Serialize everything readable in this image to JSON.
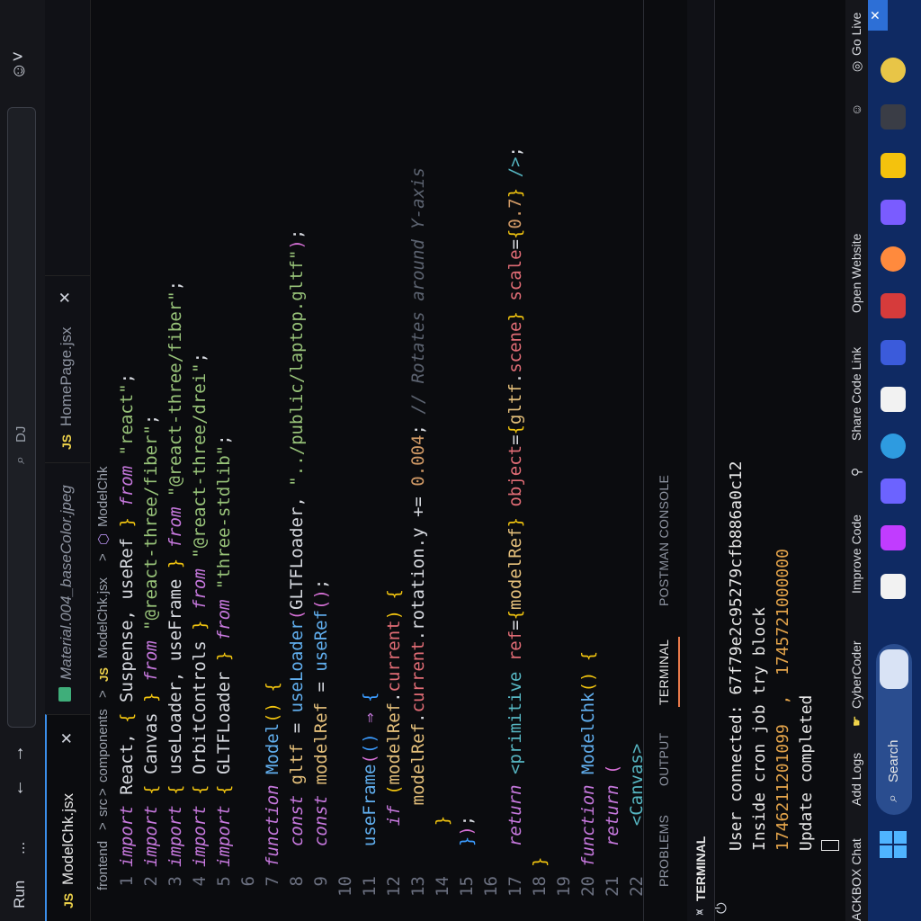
{
  "titlebar": {
    "run": "Run",
    "more": "...",
    "back": "←",
    "forward": "→",
    "search_text": "DJ"
  },
  "tabs": [
    {
      "label": "ModelChk.jsx",
      "badge": "JS",
      "close": "✕"
    },
    {
      "label": "Material.004_baseColor.jpeg"
    },
    {
      "label": "HomePage.jsx",
      "badge": "JS",
      "close": "✕"
    }
  ],
  "breadcrumb": [
    "frontend",
    ">",
    "src",
    ">",
    "components",
    ">",
    "JS",
    "ModelChk.jsx",
    ">",
    "ModelChk"
  ],
  "editor": {
    "line_numbers": [
      "1",
      "2",
      "3",
      "4",
      "5",
      "6",
      "7",
      "8",
      "9",
      "10",
      "11",
      "12",
      "13",
      "14",
      "15",
      "16",
      "17",
      "18",
      "19",
      "20",
      "21",
      "22"
    ]
  },
  "panel": {
    "tabs": [
      "PROBLEMS",
      "OUTPUT",
      "TERMINAL",
      "POSTMAN CONSOLE"
    ],
    "active_tab": "TERMINAL",
    "terminal_header": "TERMINAL",
    "output": [
      "User connected: 67f79e2c95279cfb886a0c12",
      "Inside cron job try block",
      "1746211201099  ,  1745721000000",
      "Update completed"
    ]
  },
  "statusbar": {
    "items": [
      "ACKBOX Chat",
      "Add Logs",
      "CyberCoder",
      "Improve Code",
      "Share Code Link",
      "Open Website",
      "Go Live"
    ]
  },
  "taskbar": {
    "search_label": "Search",
    "app_colors": [
      "#2d7ff9",
      "#e8c547",
      "#7a5cff",
      "#f4c20d",
      "#d63b3b",
      "#ff8a3d",
      "#c13cff",
      "#3ba3ff",
      "#f2f2f2",
      "#2e8b57",
      "#6c63ff",
      "#d9e3f5"
    ]
  }
}
